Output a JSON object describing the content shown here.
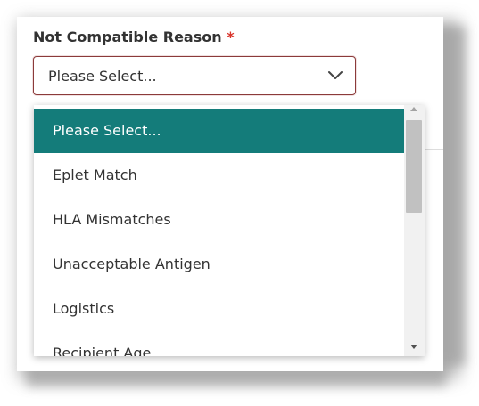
{
  "field": {
    "label": "Not Compatible Reason",
    "required_marker": "*",
    "selected_value": "Please Select..."
  },
  "dropdown": {
    "options": [
      {
        "label": "Please Select...",
        "selected": true
      },
      {
        "label": "Eplet Match",
        "selected": false
      },
      {
        "label": "HLA Mismatches",
        "selected": false
      },
      {
        "label": "Unacceptable Antigen",
        "selected": false
      },
      {
        "label": "Logistics",
        "selected": false
      },
      {
        "label": "Recipient Age",
        "selected": false
      }
    ]
  },
  "colors": {
    "selected_option_bg": "#147c7a",
    "select_border": "#8b3a3a",
    "required_star": "#d9342b"
  },
  "icons": {
    "select_toggle": "chevron-down-icon",
    "scroll_up": "scroll-up-arrow-icon",
    "scroll_down": "scroll-down-arrow-icon"
  }
}
